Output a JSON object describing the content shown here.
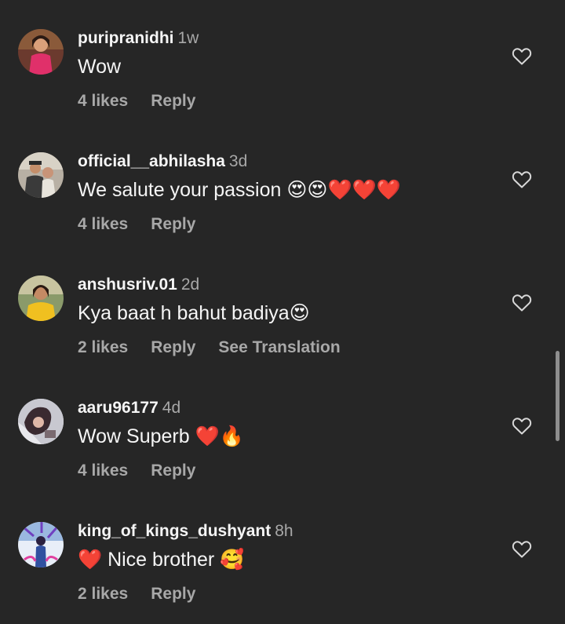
{
  "comments": [
    {
      "username": "puripranidhi",
      "time": "1w",
      "text": "Wow",
      "likes": "4 likes",
      "reply": "Reply",
      "translate": ""
    },
    {
      "username": "official__abhilasha",
      "time": "3d",
      "text": "We salute your passion 😍😍❤️❤️❤️",
      "likes": "4 likes",
      "reply": "Reply",
      "translate": ""
    },
    {
      "username": "anshusriv.01",
      "time": "2d",
      "text": "Kya baat h bahut badiya😍",
      "likes": "2 likes",
      "reply": "Reply",
      "translate": "See Translation"
    },
    {
      "username": "aaru96177",
      "time": "4d",
      "text": "Wow Superb ❤️🔥",
      "likes": "4 likes",
      "reply": "Reply",
      "translate": ""
    },
    {
      "username": "king_of_kings_dushyant",
      "time": "8h",
      "text": "❤️ Nice brother 🥰",
      "likes": "2 likes",
      "reply": "Reply",
      "translate": ""
    }
  ],
  "icons": {
    "like": "heart-outline-icon"
  },
  "colors": {
    "background": "#262626",
    "primary_text": "#f5f5f5",
    "secondary_text": "#a8a8a8"
  }
}
